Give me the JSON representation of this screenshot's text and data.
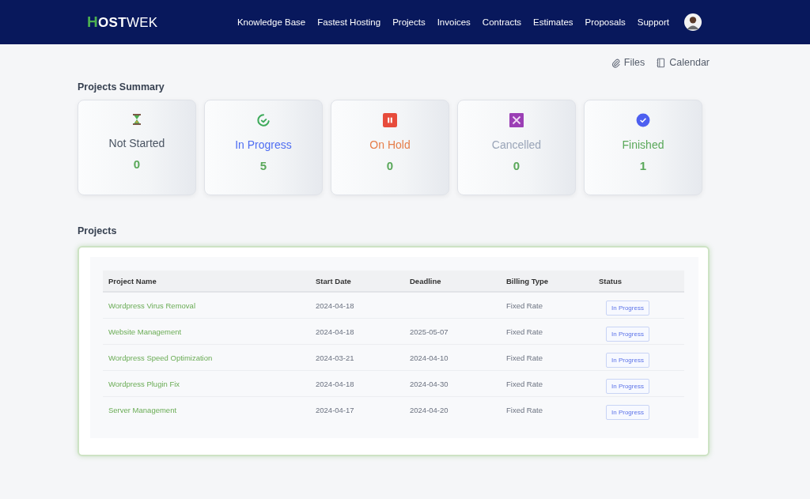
{
  "logo": {
    "mark": "H",
    "bold": "OST",
    "rest": "WEK"
  },
  "nav": [
    "Knowledge Base",
    "Fastest Hosting",
    "Projects",
    "Invoices",
    "Contracts",
    "Estimates",
    "Proposals",
    "Support"
  ],
  "links": [
    {
      "kind": "files",
      "label": "Files"
    },
    {
      "kind": "calendar",
      "label": "Calendar"
    }
  ],
  "summary": {
    "title": "Projects Summary",
    "cards": [
      {
        "kind": "not_started",
        "label": "Not Started",
        "count": "0",
        "color": "#4b5563"
      },
      {
        "kind": "in_progress",
        "label": "In Progress",
        "count": "5",
        "color": "#4f6ef2"
      },
      {
        "kind": "on_hold",
        "label": "On Hold",
        "count": "0",
        "color": "#e67e4a"
      },
      {
        "kind": "cancelled",
        "label": "Cancelled",
        "count": "0",
        "color": "#9aa5b8"
      },
      {
        "kind": "finished",
        "label": "Finished",
        "count": "1",
        "color": "#5aa85a"
      }
    ]
  },
  "projects": {
    "title": "Projects",
    "columns": [
      "Project Name",
      "Start Date",
      "Deadline",
      "Billing Type",
      "Status"
    ],
    "rows": [
      {
        "name": "Wordpress Virus Removal",
        "start": "2024-04-18",
        "billing": "Fixed Rate",
        "status": {
          "kind": "in_progress",
          "label": "In Progress"
        }
      },
      {
        "name": "Website Management",
        "start": "2024-04-18",
        "deadline": "2025-05-07",
        "billing": "Fixed Rate",
        "status": {
          "kind": "in_progress",
          "label": "In Progress"
        }
      },
      {
        "name": "Wordpress Speed Optimization",
        "start": "2024-03-21",
        "deadline": "2024-04-10",
        "billing": "Fixed Rate",
        "status": {
          "kind": "in_progress",
          "label": "In Progress"
        }
      },
      {
        "name": "Wordpress Plugin Fix",
        "start": "2024-04-18",
        "deadline": "2024-04-30",
        "billing": "Fixed Rate",
        "status": {
          "kind": "in_progress",
          "label": "In Progress"
        }
      },
      {
        "name": "Server Management",
        "start": "2024-04-17",
        "deadline": "2024-04-20",
        "billing": "Fixed Rate",
        "status": {
          "kind": "in_progress",
          "label": "In Progress"
        }
      }
    ]
  }
}
